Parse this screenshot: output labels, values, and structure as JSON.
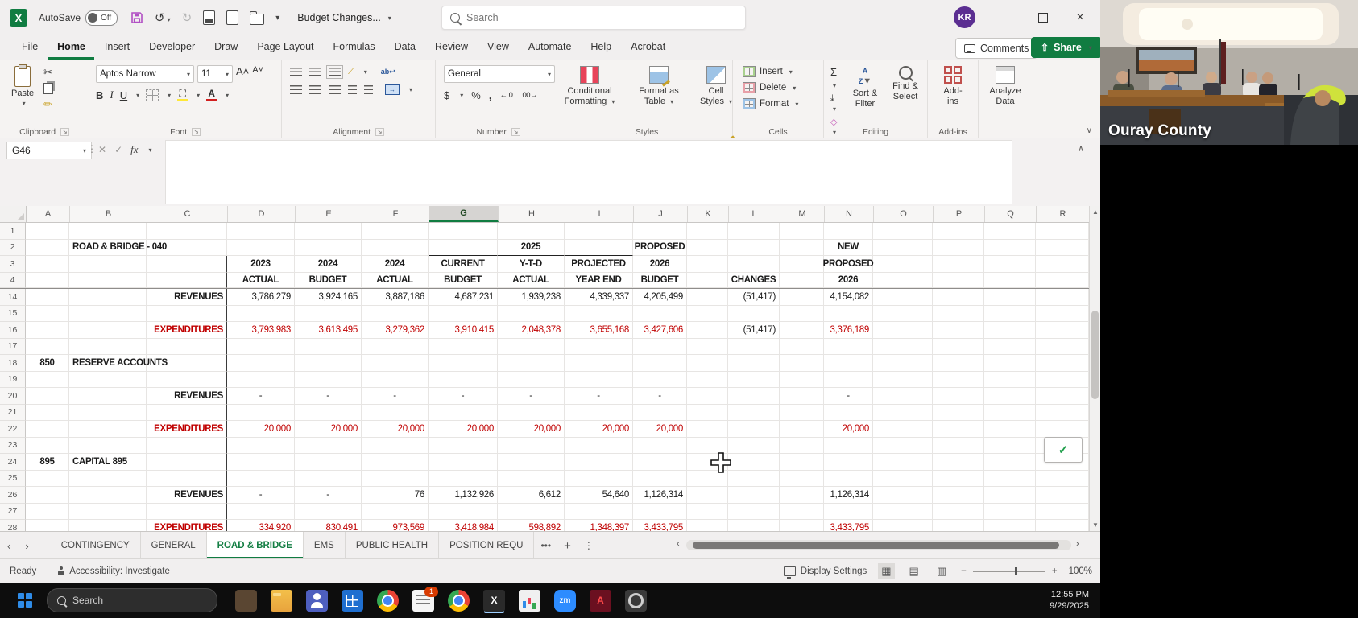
{
  "titlebar": {
    "autosave_label": "AutoSave",
    "autosave_state": "Off",
    "doc_title": "Budget Changes...",
    "search_placeholder": "Search",
    "avatar_initials": "KR"
  },
  "ribbon": {
    "tabs": [
      "File",
      "Home",
      "Insert",
      "Developer",
      "Draw",
      "Page Layout",
      "Formulas",
      "Data",
      "Review",
      "View",
      "Automate",
      "Help",
      "Acrobat"
    ],
    "active_tab_index": 1,
    "comments_label": "Comments",
    "share_label": "Share",
    "paste_label": "Paste",
    "font_name": "Aptos Narrow",
    "font_size": "11",
    "number_format": "General",
    "conditional_formatting_label": "Conditional Formatting",
    "format_as_table_label": "Format as Table",
    "cell_styles_label": "Cell Styles",
    "insert_label": "Insert",
    "delete_label": "Delete",
    "format_label": "Format",
    "sort_filter_label": "Sort & Filter",
    "find_select_label": "Find & Select",
    "addins_label": "Add-ins",
    "analyze_data_label": "Analyze Data",
    "group_labels": [
      "Clipboard",
      "Font",
      "Alignment",
      "Number",
      "Styles",
      "Cells",
      "Editing",
      "Add-ins"
    ]
  },
  "formula_bar": {
    "name_box": "G46",
    "fx_label": "fx",
    "value": ""
  },
  "grid": {
    "selected_col": "G",
    "vline_after": "C",
    "columns": [
      [
        "A",
        54
      ],
      [
        "B",
        96
      ],
      [
        "C",
        100
      ],
      [
        "D",
        84
      ],
      [
        "E",
        83
      ],
      [
        "F",
        83
      ],
      [
        "G",
        86
      ],
      [
        "H",
        83
      ],
      [
        "I",
        85
      ],
      [
        "J",
        67
      ],
      [
        "K",
        51
      ],
      [
        "L",
        64
      ],
      [
        "M",
        55
      ],
      [
        "N",
        61
      ],
      [
        "O",
        74
      ],
      [
        "P",
        64
      ],
      [
        "Q",
        64
      ],
      [
        "R",
        66
      ]
    ],
    "rows": [
      [
        "1",
        {}
      ],
      [
        "2",
        {
          "B": [
            "ROAD & BRIDGE - 040",
            "b nowrap"
          ],
          "G": [
            "",
            "bb"
          ],
          "H": [
            "2025",
            "b c bb"
          ],
          "I": [
            "",
            "bb"
          ],
          "J": [
            "PROPOSED",
            "b c"
          ],
          "N": [
            "NEW",
            "b c"
          ]
        }
      ],
      [
        "3",
        {
          "D": [
            "2023",
            "b c"
          ],
          "E": [
            "2024",
            "b c"
          ],
          "F": [
            "2024",
            "b c"
          ],
          "G": [
            "CURRENT",
            "b c"
          ],
          "H": [
            "Y-T-D",
            "b c"
          ],
          "I": [
            "PROJECTED",
            "b c"
          ],
          "J": [
            "2026",
            "b c"
          ],
          "N": [
            "PROPOSED",
            "b c"
          ]
        }
      ],
      [
        "4",
        {
          "D": [
            "ACTUAL",
            "b c"
          ],
          "E": [
            "BUDGET",
            "b c"
          ],
          "F": [
            "ACTUAL",
            "b c"
          ],
          "G": [
            "BUDGET",
            "b c"
          ],
          "H": [
            "ACTUAL",
            "b c"
          ],
          "I": [
            "YEAR END",
            "b c"
          ],
          "J": [
            "BUDGET",
            "b c"
          ],
          "L": [
            "CHANGES",
            "b c"
          ],
          "N": [
            "2026",
            "b c"
          ]
        },
        "frozen"
      ],
      [
        "14",
        {
          "C": [
            "REVENUES",
            "b r"
          ],
          "D": [
            "3,786,279",
            "n"
          ],
          "E": [
            "3,924,165",
            "n"
          ],
          "F": [
            "3,887,186",
            "n"
          ],
          "G": [
            "4,687,231",
            "n"
          ],
          "H": [
            "1,939,238",
            "n"
          ],
          "I": [
            "4,339,337",
            "n"
          ],
          "J": [
            "4,205,499",
            "n"
          ],
          "L": [
            "(51,417)",
            "n"
          ],
          "N": [
            "4,154,082",
            "n"
          ]
        }
      ],
      [
        "15",
        {}
      ],
      [
        "16",
        {
          "C": [
            "EXPENDITURES",
            "b r red"
          ],
          "D": [
            "3,793,983",
            "n red"
          ],
          "E": [
            "3,613,495",
            "n red"
          ],
          "F": [
            "3,279,362",
            "n red"
          ],
          "G": [
            "3,910,415",
            "n red"
          ],
          "H": [
            "2,048,378",
            "n red"
          ],
          "I": [
            "3,655,168",
            "n red"
          ],
          "J": [
            "3,427,606",
            "n red"
          ],
          "L": [
            "(51,417)",
            "n"
          ],
          "N": [
            "3,376,189",
            "n red"
          ]
        }
      ],
      [
        "17",
        {}
      ],
      [
        "18",
        {
          "A": [
            "850",
            "b c"
          ],
          "B": [
            "RESERVE ACCOUNTS",
            "b nowrap"
          ]
        }
      ],
      [
        "19",
        {}
      ],
      [
        "20",
        {
          "C": [
            "REVENUES",
            "b r"
          ],
          "D": [
            "-",
            "dash"
          ],
          "E": [
            "-",
            "dash"
          ],
          "F": [
            "-",
            "dash"
          ],
          "G": [
            "-",
            "dash"
          ],
          "H": [
            "-",
            "dash"
          ],
          "I": [
            "-",
            "dash"
          ],
          "J": [
            "-",
            "dash"
          ],
          "N": [
            "-",
            "dash"
          ]
        }
      ],
      [
        "21",
        {}
      ],
      [
        "22",
        {
          "C": [
            "EXPENDITURES",
            "b r red"
          ],
          "D": [
            "20,000",
            "n red"
          ],
          "E": [
            "20,000",
            "n red"
          ],
          "F": [
            "20,000",
            "n red"
          ],
          "G": [
            "20,000",
            "n red"
          ],
          "H": [
            "20,000",
            "n red"
          ],
          "I": [
            "20,000",
            "n red"
          ],
          "J": [
            "20,000",
            "n red"
          ],
          "N": [
            "20,000",
            "n red"
          ]
        }
      ],
      [
        "23",
        {}
      ],
      [
        "24",
        {
          "A": [
            "895",
            "b c"
          ],
          "B": [
            "CAPITAL 895",
            "b nowrap"
          ]
        }
      ],
      [
        "25",
        {}
      ],
      [
        "26",
        {
          "C": [
            "REVENUES",
            "b r"
          ],
          "D": [
            "-",
            "dash"
          ],
          "E": [
            "-",
            "dash"
          ],
          "F": [
            "76",
            "n"
          ],
          "G": [
            "1,132,926",
            "n"
          ],
          "H": [
            "6,612",
            "n"
          ],
          "I": [
            "54,640",
            "n"
          ],
          "J": [
            "1,126,314",
            "n"
          ],
          "N": [
            "1,126,314",
            "n"
          ]
        }
      ],
      [
        "27",
        {}
      ],
      [
        "28",
        {
          "C": [
            "EXPENDITURES",
            "b r red"
          ],
          "D": [
            "334,920",
            "n red"
          ],
          "E": [
            "830,491",
            "n red"
          ],
          "F": [
            "973,569",
            "n red"
          ],
          "G": [
            "3,418,984",
            "n red"
          ],
          "H": [
            "598,892",
            "n red"
          ],
          "I": [
            "1,348,397",
            "n red"
          ],
          "J": [
            "3,433,795",
            "n red"
          ],
          "N": [
            "3,433,795",
            "n red"
          ]
        }
      ]
    ]
  },
  "sheets": {
    "tabs": [
      "CONTINGENCY",
      "GENERAL",
      "ROAD & BRIDGE",
      "EMS",
      "PUBLIC HEALTH",
      "POSITION REQU"
    ],
    "active_index": 2,
    "overflow_indicator": "•••",
    "add_sheet_label": "+",
    "more_label": "⋮"
  },
  "statusbar": {
    "ready_label": "Ready",
    "accessibility_label": "Accessibility: Investigate",
    "display_settings_label": "Display Settings",
    "zoom_level": "100%"
  },
  "taskbar": {
    "search_placeholder": "Search",
    "clock_time": "12:55 PM",
    "clock_date": "9/29/2025",
    "apps": [
      {
        "name": "pinned-app-1",
        "cls": "a1"
      },
      {
        "name": "file-explorer-app",
        "cls": "folder"
      },
      {
        "name": "teams-app",
        "cls": "teams"
      },
      {
        "name": "pinned-blue-app",
        "cls": "bluegrid"
      },
      {
        "name": "chrome-browser",
        "cls": "chrome"
      },
      {
        "name": "notes-app",
        "cls": "notes",
        "badge": "1"
      },
      {
        "name": "chrome-browser-2",
        "cls": "chrome"
      },
      {
        "name": "excel-app",
        "cls": "excel",
        "label": "X",
        "active": true
      },
      {
        "name": "chart-app",
        "cls": "chartapp"
      },
      {
        "name": "zoom-app",
        "cls": "zoomapp",
        "label": "zm"
      },
      {
        "name": "acrobat-app",
        "cls": "acrobat",
        "label": "A"
      },
      {
        "name": "settings-app",
        "cls": "gear"
      }
    ]
  },
  "video": {
    "caption": "Ouray County"
  },
  "colors": {
    "excel_green": "#107c41",
    "red_text": "#c00000",
    "taskbar_bg": "#0d0d0d"
  }
}
